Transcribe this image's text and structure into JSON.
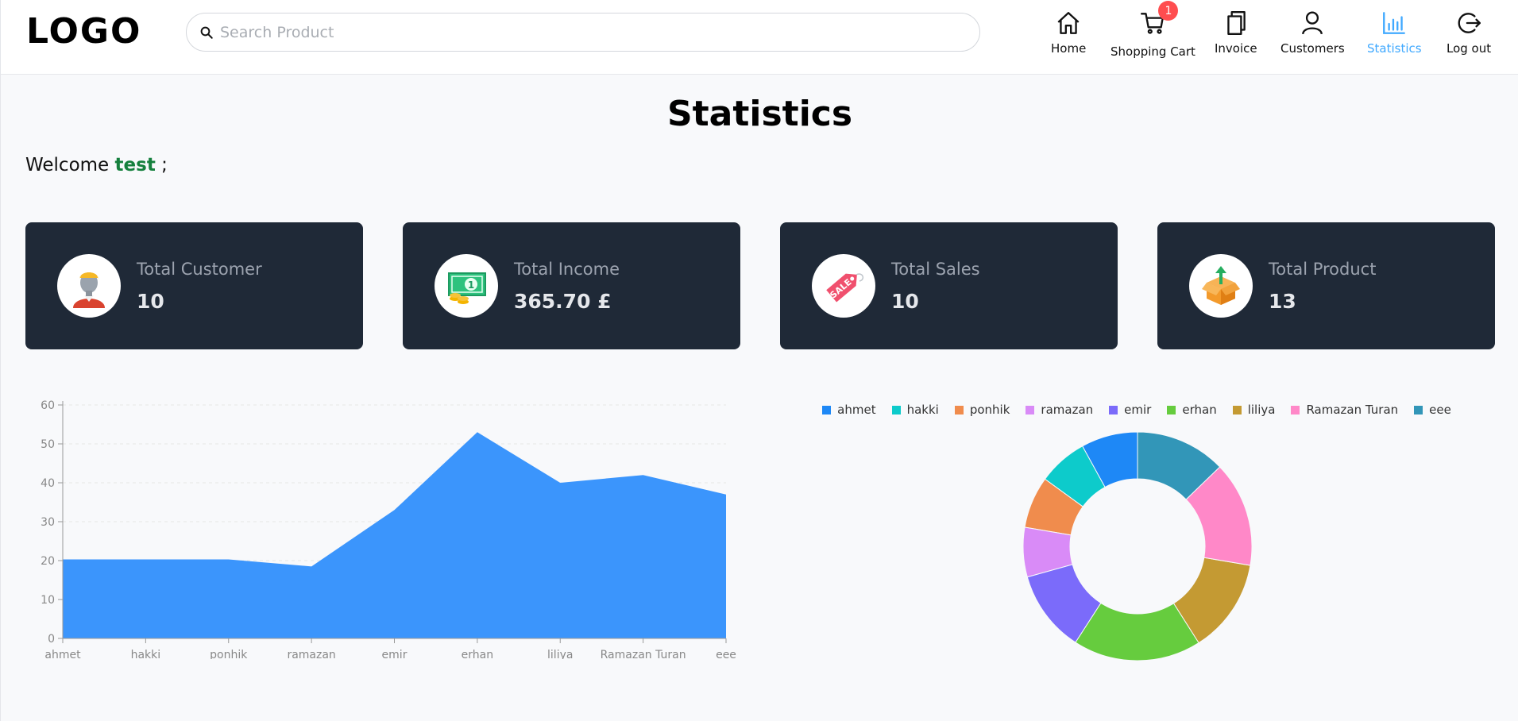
{
  "header": {
    "logo": "LOGO",
    "search_placeholder": "Search Product",
    "nav": [
      {
        "label": "Home",
        "icon": "home-icon"
      },
      {
        "label": "Shopping Cart",
        "icon": "cart-icon",
        "badge": "1"
      },
      {
        "label": "Invoice",
        "icon": "invoice-icon"
      },
      {
        "label": "Customers",
        "icon": "user-icon"
      },
      {
        "label": "Statistics",
        "icon": "bar-chart-icon",
        "active": true
      },
      {
        "label": "Log out",
        "icon": "logout-icon"
      }
    ]
  },
  "page": {
    "title": "Statistics",
    "welcome_prefix": "Welcome",
    "username": "test",
    "welcome_suffix": ";"
  },
  "cards": [
    {
      "label": "Total Customer",
      "value": "10",
      "icon": "customer-icon"
    },
    {
      "label": "Total Income",
      "value": "365.70 £",
      "icon": "money-icon"
    },
    {
      "label": "Total Sales",
      "value": "10",
      "icon": "sale-tag-icon"
    },
    {
      "label": "Total Product",
      "value": "13",
      "icon": "product-box-icon"
    }
  ],
  "colors": {
    "accent": "#40a9ff",
    "card_bg": "#1f2937",
    "welcome_user": "#15803d",
    "area_fill": "#3b95fc",
    "badge": "#ff4d4f"
  },
  "chart_data": [
    {
      "type": "area",
      "categories": [
        "ahmet",
        "hakki",
        "ponhik",
        "ramazan",
        "emir",
        "erhan",
        "liliya",
        "Ramazan Turan",
        "eee"
      ],
      "values": [
        20.3,
        20.3,
        20.3,
        18.5,
        33,
        53,
        40,
        42,
        37
      ],
      "yticks": [
        0,
        10,
        20,
        30,
        40,
        50,
        60
      ],
      "ylim": [
        0,
        60
      ],
      "grid": true
    },
    {
      "type": "pie",
      "donut": true,
      "categories": [
        "ahmet",
        "hakki",
        "ponhik",
        "ramazan",
        "emir",
        "erhan",
        "liliya",
        "Ramazan Turan",
        "eee"
      ],
      "values": [
        7.2,
        6.3,
        6.6,
        6.3,
        10.4,
        16.3,
        12.0,
        13.4,
        11.5
      ],
      "colors": [
        "#1e88f6",
        "#0dcbcb",
        "#f08c4d",
        "#d98bf7",
        "#7b6bfa",
        "#66cc3e",
        "#c49a33",
        "#ff88c8",
        "#3296b8"
      ],
      "legend_position": "top"
    }
  ]
}
